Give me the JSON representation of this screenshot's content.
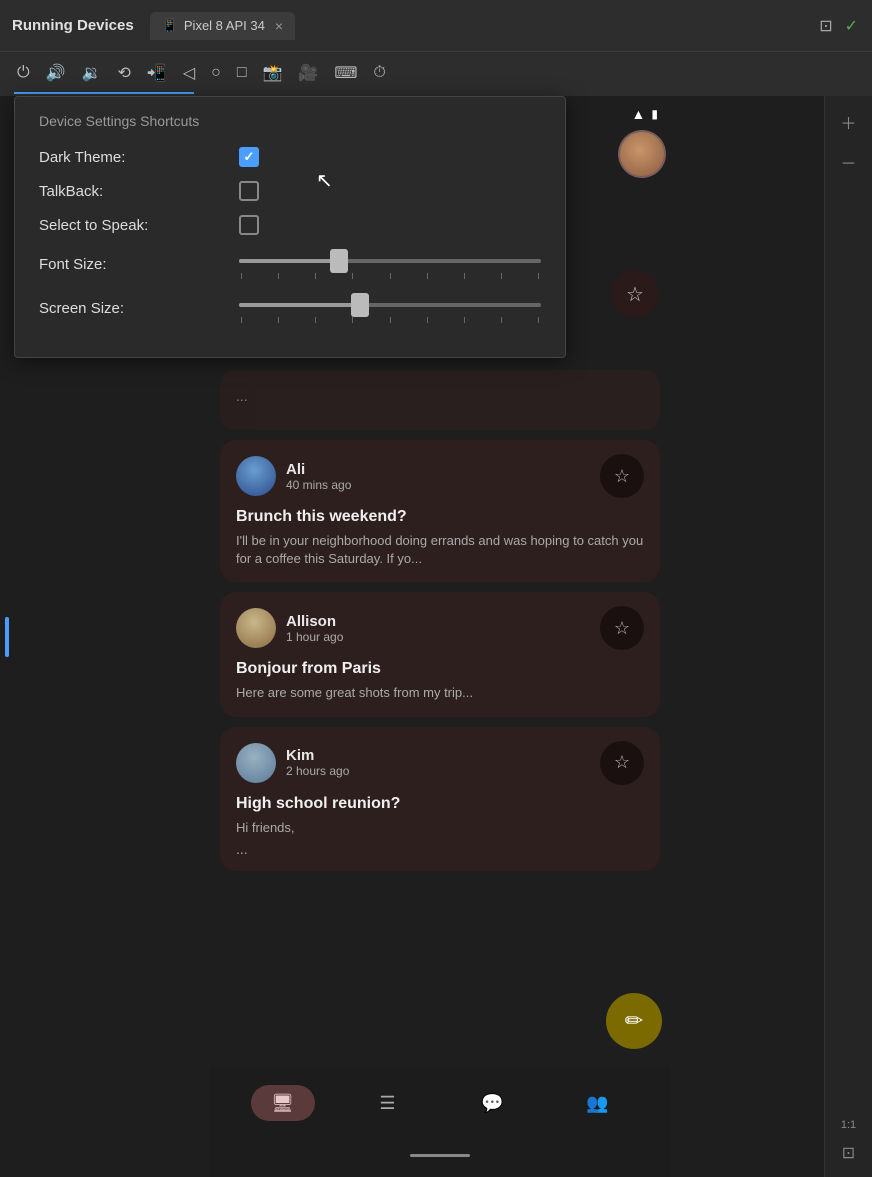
{
  "topbar": {
    "title": "Running Devices",
    "tab_label": "Pixel 8 API 34",
    "tab_close": "×"
  },
  "toolbar": {
    "icons": [
      "⏻",
      "🔊",
      "🔉",
      "📱",
      "📲",
      "◁",
      "⬜",
      "⬜",
      "📸",
      "🎥",
      "⌨️",
      "⏱"
    ],
    "active_index": 4
  },
  "popup": {
    "title": "Device Settings Shortcuts",
    "settings": [
      {
        "label": "Dark Theme:",
        "type": "checkbox",
        "checked": true
      },
      {
        "label": "TalkBack:",
        "type": "checkbox",
        "checked": false
      },
      {
        "label": "Select to Speak:",
        "type": "checkbox",
        "checked": false
      },
      {
        "label": "Font Size:",
        "type": "slider",
        "value": 35
      },
      {
        "label": "Screen Size:",
        "type": "slider",
        "value": 42
      }
    ]
  },
  "emails": [
    {
      "name": "Ali",
      "time": "40 mins ago",
      "subject": "Brunch this weekend?",
      "preview": "I'll be in your neighborhood doing errands and was hoping to catch you for a coffee this Saturday. If yo...",
      "avatar_type": "ali"
    },
    {
      "name": "Allison",
      "time": "1 hour ago",
      "subject": "Bonjour from Paris",
      "preview": "Here are some great shots from my trip...",
      "avatar_type": "allison"
    },
    {
      "name": "Kim",
      "time": "2 hours ago",
      "subject": "High school reunion?",
      "preview": "Hi friends,",
      "ellipsis": "...",
      "avatar_type": "kim"
    }
  ],
  "nav": {
    "items": [
      {
        "icon": "🖥",
        "active": true
      },
      {
        "icon": "☰",
        "active": false
      },
      {
        "icon": "💬",
        "active": false
      },
      {
        "icon": "👥",
        "active": false
      }
    ]
  },
  "status": {
    "wifi": "▲",
    "battery": "🔋"
  },
  "side_panel": {
    "ratio": "1:1"
  }
}
